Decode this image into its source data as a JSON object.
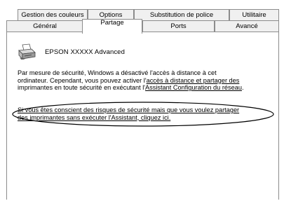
{
  "tabs_back": [
    {
      "label": "Gestion des couleurs"
    },
    {
      "label": "Options"
    },
    {
      "label": "Substitution de police"
    },
    {
      "label": "Utilitaire"
    }
  ],
  "tabs_front": [
    {
      "label": "Général"
    },
    {
      "label": "Partage"
    },
    {
      "label": "Ports"
    },
    {
      "label": "Avancé"
    }
  ],
  "active_tab": "Partage",
  "printer": {
    "name": "EPSON XXXXX Advanced",
    "icon": "printer-icon"
  },
  "security_message": {
    "line1": "Par mesure de sécurité, Windows a désactivé l'accès à distance à cet",
    "line2_a": "ordinateur. Cependant, vous pouvez activer l'",
    "line2_link": "accès à distance et partager des",
    "line3_a": "imprimantes en toute sécurité en exécutant l'",
    "line3_link": "Assistant Configuration du réseau",
    "line3_end": "."
  },
  "alternative_link": {
    "line1": "Si vous êtes conscient des risques de sécurité mais que vous voulez partager",
    "line2": "des imprimantes sans exécuter l'Assistant, cliquez ici."
  },
  "colors": {
    "tab_border": "#8c8c8c",
    "tab_background": "#f0f0f0",
    "panel_background": "#ffffff",
    "highlight_ellipse": "#000000"
  }
}
